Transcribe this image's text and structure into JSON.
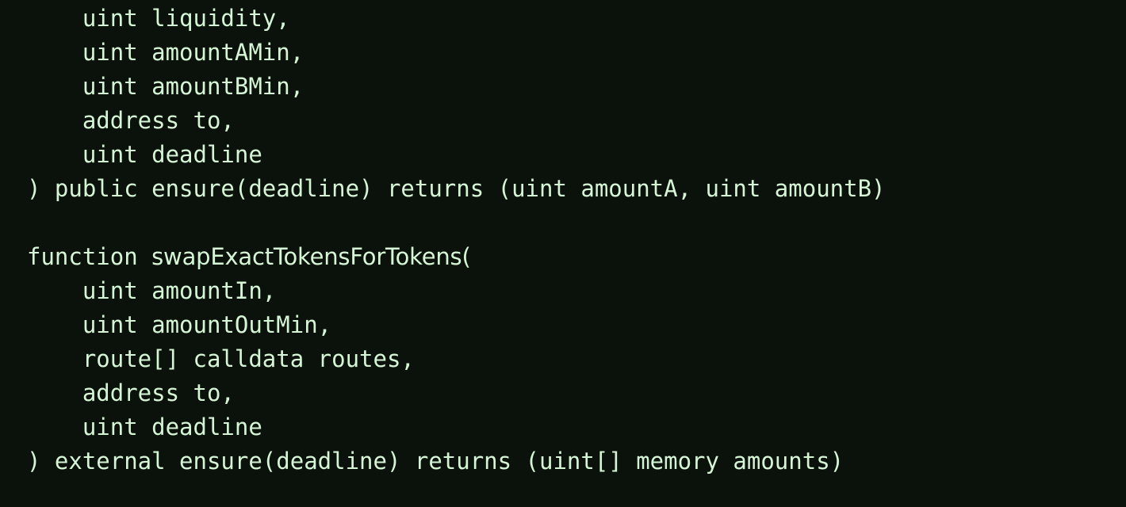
{
  "editor": {
    "background_color": "#0b120b",
    "text_color": "#d6f5d6",
    "language": "solidity"
  },
  "code": {
    "lines": [
      {
        "id": "line-1",
        "text": "    uint liquidity,"
      },
      {
        "id": "line-2",
        "text": "    uint amountAMin,"
      },
      {
        "id": "line-3",
        "text": "    uint amountBMin,"
      },
      {
        "id": "line-4",
        "text": "    address to,"
      },
      {
        "id": "line-5",
        "text": "    uint deadline"
      },
      {
        "id": "line-6",
        "text": ") public ensure(deadline) returns (uint amountA, uint amountB)"
      },
      {
        "id": "line-7",
        "text": ""
      },
      {
        "id": "line-8",
        "text": "function swapExactTokensForTokens(",
        "prefix": "function ",
        "identifier": "swapExactTokensForTokens("
      },
      {
        "id": "line-9",
        "text": "    uint amountIn,"
      },
      {
        "id": "line-10",
        "text": "    uint amountOutMin,"
      },
      {
        "id": "line-11",
        "text": "    route[] calldata routes,"
      },
      {
        "id": "line-12",
        "text": "    address to,"
      },
      {
        "id": "line-13",
        "text": "    uint deadline"
      },
      {
        "id": "line-14",
        "text": ") external ensure(deadline) returns (uint[] memory amounts)"
      }
    ]
  }
}
